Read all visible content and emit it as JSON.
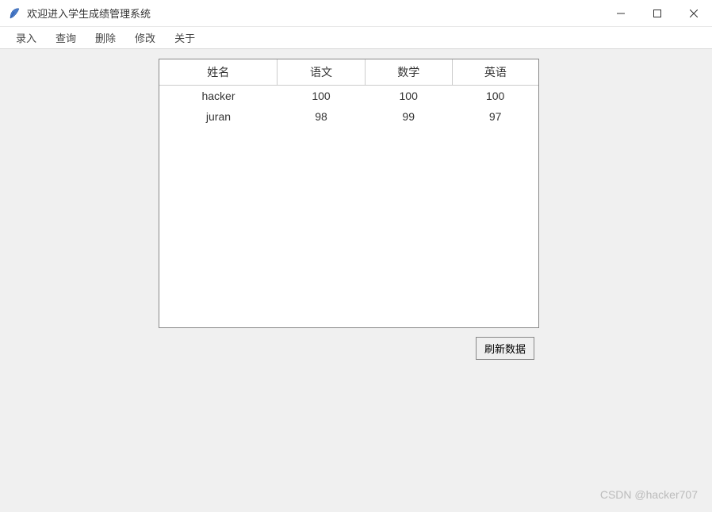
{
  "window": {
    "title": "欢迎进入学生成绩管理系统"
  },
  "menubar": {
    "items": [
      "录入",
      "查询",
      "删除",
      "修改",
      "关于"
    ]
  },
  "table": {
    "headers": [
      "姓名",
      "语文",
      "数学",
      "英语"
    ],
    "rows": [
      {
        "name": "hacker",
        "chinese": "100",
        "math": "100",
        "english": "100"
      },
      {
        "name": "juran",
        "chinese": "98",
        "math": "99",
        "english": "97"
      }
    ]
  },
  "buttons": {
    "refresh": "刷新数据"
  },
  "watermark": "CSDN @hacker707"
}
